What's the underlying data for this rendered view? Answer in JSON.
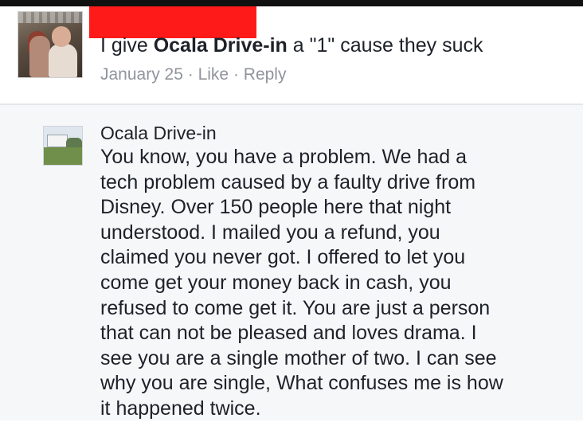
{
  "comment": {
    "text_prefix": "I give ",
    "text_page": "Ocala Drive-in",
    "text_suffix": " a \"1\" cause they suck",
    "date": "January 25",
    "separator": " · ",
    "like_label": "Like",
    "reply_label": "Reply",
    "redaction_color": "#ff1a1a"
  },
  "reply": {
    "author": "Ocala Drive-in",
    "lines": [
      "You know,  you have a problem.  We had a",
      "tech problem caused by a faulty drive from",
      "Disney. Over 150 people here that night",
      "understood. I mailed you a refund, you",
      "claimed you never got. I offered to let you",
      "come get your money back in cash, you",
      "refused to come get it. You are just a person",
      "that can not be pleased and loves drama. I",
      "see you are a single mother of two. I can see",
      "why you are single, What confuses me is how",
      "it happened twice."
    ]
  }
}
